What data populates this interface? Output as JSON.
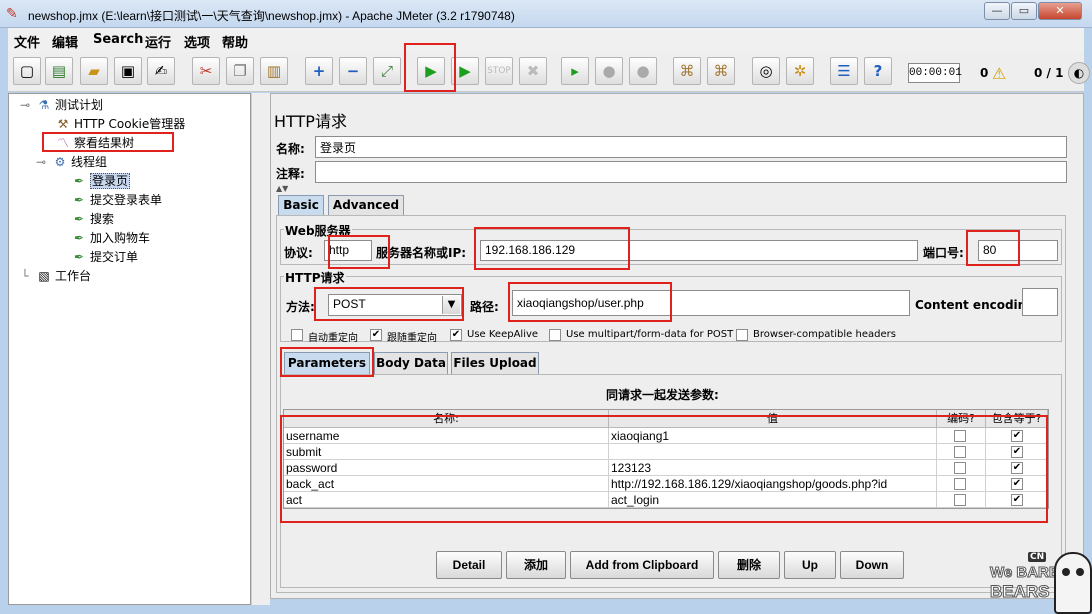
{
  "window": {
    "title": "newshop.jmx (E:\\learn\\接口测试\\一\\天气查询\\newshop.jmx) - Apache JMeter (3.2 r1790748)",
    "minimize": "—",
    "restore": "▭",
    "close": "✕"
  },
  "menu": [
    "文件",
    "编辑",
    "Search",
    "运行",
    "选项",
    "帮助"
  ],
  "toolbar": {
    "timer": "00:00:01",
    "error_count": "0",
    "thread_ratio": "0 / 1"
  },
  "tree": {
    "root": "测试计划",
    "cookie_manager": "HTTP Cookie管理器",
    "result_tree": "察看结果树",
    "thread_group": "线程组",
    "samplers": [
      "登录页",
      "提交登录表单",
      "搜索",
      "加入购物车",
      "提交订单"
    ],
    "workbench": "工作台"
  },
  "panel": {
    "heading": "HTTP请求",
    "name_label": "名称:",
    "name_value": "登录页",
    "comment_label": "注释:",
    "comment_value": "",
    "tabs": [
      "Basic",
      "Advanced"
    ],
    "web_server_group": "Web服务器",
    "protocol_label": "协议:",
    "protocol_value": "http",
    "server_label": "服务器名称或IP:",
    "server_value": "192.168.186.129",
    "port_label": "端口号:",
    "port_value": "80",
    "http_request_group": "HTTP请求",
    "method_label": "方法:",
    "method_value": "POST",
    "path_label": "路径:",
    "path_value": "xiaoqiangshop/user.php",
    "encoding_label": "Content encoding:",
    "encoding_value": "",
    "options": [
      {
        "label": "自动重定向",
        "checked": false
      },
      {
        "label": "跟随重定向",
        "checked": true
      },
      {
        "label": "Use KeepAlive",
        "checked": true
      },
      {
        "label": "Use multipart/form-data for POST",
        "checked": false
      },
      {
        "label": "Browser-compatible headers",
        "checked": false
      }
    ],
    "sub_tabs": [
      "Parameters",
      "Body Data",
      "Files Upload"
    ],
    "params_caption": "同请求一起发送参数:",
    "columns": [
      "名称:",
      "值",
      "编码?",
      "包含等于?"
    ],
    "params": [
      {
        "name": "username",
        "value": "xiaoqiang1",
        "encode": false,
        "include_equals": true
      },
      {
        "name": "submit",
        "value": "",
        "encode": false,
        "include_equals": true
      },
      {
        "name": "password",
        "value": "123123",
        "encode": false,
        "include_equals": true
      },
      {
        "name": "back_act",
        "value": "http://192.168.186.129/xiaoqiangshop/goods.php?id",
        "encode": false,
        "include_equals": true
      },
      {
        "name": "act",
        "value": "act_login",
        "encode": false,
        "include_equals": true
      }
    ],
    "buttons": [
      "Detail",
      "添加",
      "Add from Clipboard",
      "删除",
      "Up",
      "Down"
    ]
  },
  "watermark": {
    "line1": "CN",
    "line2": "We BARE",
    "line3": "BEARS"
  },
  "colors": {
    "highlight_box": "#e0221e",
    "run_icon": "#1e9e1e",
    "tab_active": "#c9dbee"
  }
}
